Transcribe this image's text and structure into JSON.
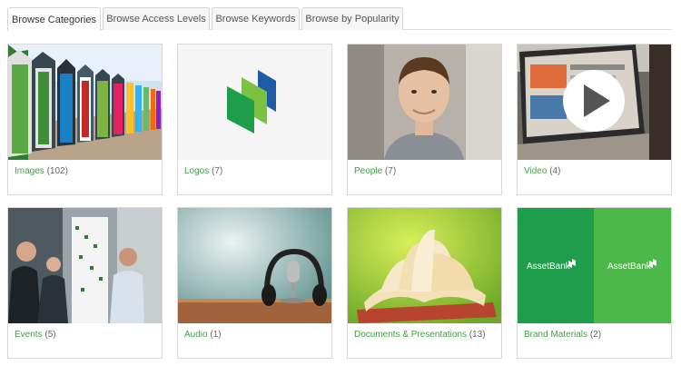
{
  "tabs": [
    {
      "label": "Browse Categories",
      "active": true
    },
    {
      "label": "Browse Access Levels",
      "active": false
    },
    {
      "label": "Browse Keywords",
      "active": false
    },
    {
      "label": "Browse by Popularity",
      "active": false
    }
  ],
  "categories": [
    {
      "name": "Images",
      "count": "(102)"
    },
    {
      "name": "Logos",
      "count": "(7)"
    },
    {
      "name": "People",
      "count": "(7)"
    },
    {
      "name": "Video",
      "count": "(4)"
    },
    {
      "name": "Events",
      "count": "(5)"
    },
    {
      "name": "Audio",
      "count": "(1)"
    },
    {
      "name": "Documents & Presentations",
      "count": "(13)"
    },
    {
      "name": "Brand Materials",
      "count": "(2)"
    }
  ],
  "brand_thumb_text": "AssetBank",
  "colors": {
    "link": "#43a047",
    "brand_dark": "#1e9e4a",
    "brand_light": "#4cb84a",
    "logo_blue": "#1f5aa6"
  }
}
